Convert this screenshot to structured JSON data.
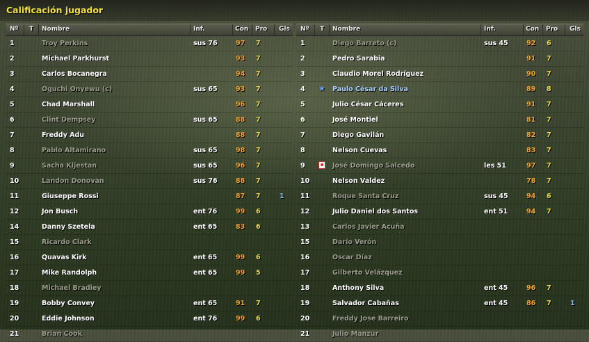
{
  "window": {
    "title": "Calificación jugador"
  },
  "columns": {
    "num": "Nº",
    "t": "T",
    "name": "Nombre",
    "inf": "Inf.",
    "con": "Con",
    "pro": "Pro",
    "gls": "Gls"
  },
  "left_team": [
    {
      "num": "1",
      "name": "Troy Perkins",
      "inf": "sus 76",
      "con": "97",
      "pro": "7",
      "gls": "",
      "state": "sub",
      "icon": ""
    },
    {
      "num": "2",
      "name": "Michael Parkhurst",
      "inf": "",
      "con": "93",
      "pro": "7",
      "gls": "",
      "state": "",
      "icon": ""
    },
    {
      "num": "3",
      "name": "Carlos Bocanegra",
      "inf": "",
      "con": "94",
      "pro": "7",
      "gls": "",
      "state": "",
      "icon": ""
    },
    {
      "num": "4",
      "name": "Oguchi Onyewu (c)",
      "inf": "sus 65",
      "con": "93",
      "pro": "7",
      "gls": "",
      "state": "sub",
      "icon": ""
    },
    {
      "num": "5",
      "name": "Chad Marshall",
      "inf": "",
      "con": "96",
      "pro": "7",
      "gls": "",
      "state": "",
      "icon": ""
    },
    {
      "num": "6",
      "name": "Clint Dempsey",
      "inf": "sus 65",
      "con": "88",
      "pro": "7",
      "gls": "",
      "state": "sub",
      "icon": ""
    },
    {
      "num": "7",
      "name": "Freddy Adu",
      "inf": "",
      "con": "88",
      "pro": "7",
      "gls": "",
      "state": "",
      "icon": ""
    },
    {
      "num": "8",
      "name": "Pablo Altamirano",
      "inf": "sus 65",
      "con": "98",
      "pro": "7",
      "gls": "",
      "state": "sub",
      "icon": ""
    },
    {
      "num": "9",
      "name": "Sacha Kljestan",
      "inf": "sus 65",
      "con": "96",
      "pro": "7",
      "gls": "",
      "state": "sub",
      "icon": ""
    },
    {
      "num": "10",
      "name": "Landon Donovan",
      "inf": "sus 76",
      "con": "88",
      "pro": "7",
      "gls": "",
      "state": "sub",
      "icon": ""
    },
    {
      "num": "11",
      "name": "Giuseppe Rossi",
      "inf": "",
      "con": "87",
      "pro": "7",
      "gls": "1",
      "state": "",
      "icon": ""
    },
    {
      "num": "12",
      "name": "Jon Busch",
      "inf": "ent 76",
      "con": "99",
      "pro": "6",
      "gls": "",
      "state": "",
      "icon": ""
    },
    {
      "num": "14",
      "name": "Danny Szetela",
      "inf": "ent 65",
      "con": "83",
      "pro": "6",
      "gls": "",
      "state": "",
      "icon": ""
    },
    {
      "num": "15",
      "name": "Ricardo Clark",
      "inf": "",
      "con": "",
      "pro": "",
      "gls": "",
      "state": "sub",
      "icon": ""
    },
    {
      "num": "16",
      "name": "Quavas Kirk",
      "inf": "ent 65",
      "con": "99",
      "pro": "6",
      "gls": "",
      "state": "",
      "icon": ""
    },
    {
      "num": "17",
      "name": "Mike Randolph",
      "inf": "ent 65",
      "con": "99",
      "pro": "5",
      "gls": "",
      "state": "",
      "icon": ""
    },
    {
      "num": "18",
      "name": "Michael Bradley",
      "inf": "",
      "con": "",
      "pro": "",
      "gls": "",
      "state": "sub",
      "icon": ""
    },
    {
      "num": "19",
      "name": "Bobby Convey",
      "inf": "ent 65",
      "con": "91",
      "pro": "7",
      "gls": "",
      "state": "",
      "icon": ""
    },
    {
      "num": "20",
      "name": "Eddie Johnson",
      "inf": "ent 76",
      "con": "99",
      "pro": "6",
      "gls": "",
      "state": "",
      "icon": ""
    },
    {
      "num": "21",
      "name": "Brian Cook",
      "inf": "",
      "con": "",
      "pro": "",
      "gls": "",
      "state": "sub",
      "icon": ""
    }
  ],
  "right_team": [
    {
      "num": "1",
      "name": "Diego Barreto (c)",
      "inf": "sus 45",
      "con": "92",
      "pro": "6",
      "gls": "",
      "state": "sub",
      "icon": ""
    },
    {
      "num": "2",
      "name": "Pedro Sarabia",
      "inf": "",
      "con": "91",
      "pro": "7",
      "gls": "",
      "state": "",
      "icon": ""
    },
    {
      "num": "3",
      "name": "Claudio Morel Rodríguez",
      "inf": "",
      "con": "90",
      "pro": "7",
      "gls": "",
      "state": "",
      "icon": ""
    },
    {
      "num": "4",
      "name": "Paulo César da Silva",
      "inf": "",
      "con": "89",
      "pro": "8",
      "gls": "",
      "state": "hl",
      "icon": "star-icon"
    },
    {
      "num": "5",
      "name": "Julio César Cáceres",
      "inf": "",
      "con": "91",
      "pro": "7",
      "gls": "",
      "state": "",
      "icon": ""
    },
    {
      "num": "6",
      "name": "José Montiel",
      "inf": "",
      "con": "81",
      "pro": "7",
      "gls": "",
      "state": "",
      "icon": ""
    },
    {
      "num": "7",
      "name": "Diego Gavilán",
      "inf": "",
      "con": "82",
      "pro": "7",
      "gls": "",
      "state": "",
      "icon": ""
    },
    {
      "num": "8",
      "name": "Nelson Cuevas",
      "inf": "",
      "con": "83",
      "pro": "7",
      "gls": "",
      "state": "",
      "icon": ""
    },
    {
      "num": "9",
      "name": "José Domingo Salcedo",
      "inf": "les 51",
      "con": "97",
      "pro": "7",
      "gls": "",
      "state": "sub",
      "icon": "injury-icon"
    },
    {
      "num": "10",
      "name": "Nelson Valdez",
      "inf": "",
      "con": "78",
      "pro": "7",
      "gls": "",
      "state": "",
      "icon": ""
    },
    {
      "num": "11",
      "name": "Roque Santa Cruz",
      "inf": "sus 45",
      "con": "94",
      "pro": "6",
      "gls": "",
      "state": "sub",
      "icon": ""
    },
    {
      "num": "12",
      "name": "Julio Daniel dos Santos",
      "inf": "ent 51",
      "con": "94",
      "pro": "7",
      "gls": "",
      "state": "",
      "icon": ""
    },
    {
      "num": "13",
      "name": "Carlos Javier Acuña",
      "inf": "",
      "con": "",
      "pro": "",
      "gls": "",
      "state": "sub",
      "icon": ""
    },
    {
      "num": "15",
      "name": "Darío Verón",
      "inf": "",
      "con": "",
      "pro": "",
      "gls": "",
      "state": "sub",
      "icon": ""
    },
    {
      "num": "16",
      "name": "Oscar Díaz",
      "inf": "",
      "con": "",
      "pro": "",
      "gls": "",
      "state": "sub",
      "icon": ""
    },
    {
      "num": "17",
      "name": "Gilberto Velázquez",
      "inf": "",
      "con": "",
      "pro": "",
      "gls": "",
      "state": "sub",
      "icon": ""
    },
    {
      "num": "18",
      "name": "Anthony Silva",
      "inf": "ent 45",
      "con": "96",
      "pro": "7",
      "gls": "",
      "state": "",
      "icon": ""
    },
    {
      "num": "19",
      "name": "Salvador Cabañas",
      "inf": "ent 45",
      "con": "86",
      "pro": "7",
      "gls": "1",
      "state": "",
      "icon": ""
    },
    {
      "num": "20",
      "name": "Freddy Jose Barreiro",
      "inf": "",
      "con": "",
      "pro": "",
      "gls": "",
      "state": "sub",
      "icon": ""
    },
    {
      "num": "21",
      "name": "Julio Manzur",
      "inf": "",
      "con": "",
      "pro": "",
      "gls": "",
      "state": "sub",
      "icon": ""
    }
  ]
}
